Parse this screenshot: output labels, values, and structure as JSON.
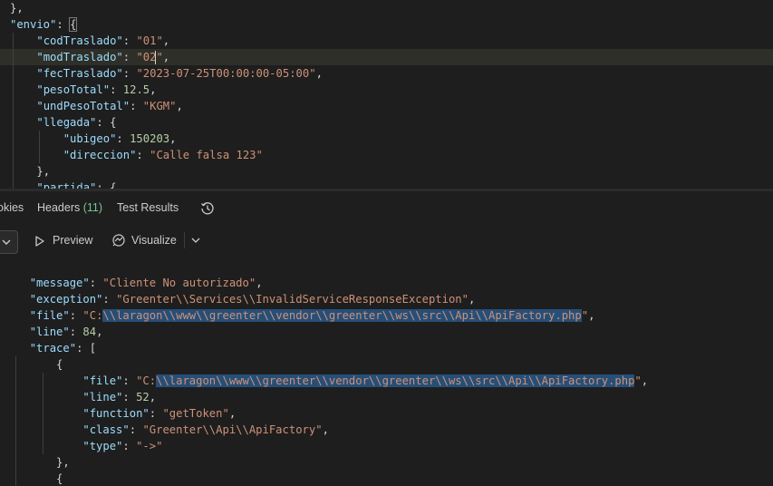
{
  "request_body": {
    "lines": [
      {
        "indent": "",
        "parts": [
          {
            "c": "p",
            "t": "},"
          }
        ]
      },
      {
        "indent": "",
        "parts": [
          {
            "c": "k",
            "t": "\"envio\""
          },
          {
            "c": "p",
            "t": ": "
          },
          {
            "c": "p",
            "t": "{",
            "box": true
          }
        ]
      },
      {
        "indent": "    ",
        "parts": [
          {
            "c": "k",
            "t": "\"codTraslado\""
          },
          {
            "c": "p",
            "t": ": "
          },
          {
            "c": "s",
            "t": "\"01\""
          },
          {
            "c": "p",
            "t": ","
          }
        ]
      },
      {
        "indent": "    ",
        "parts": [
          {
            "c": "k",
            "t": "\"modTraslado\""
          },
          {
            "c": "p",
            "t": ": "
          },
          {
            "c": "s",
            "t": "\"02\""
          },
          {
            "c": "p",
            "t": ","
          }
        ],
        "highlight": true
      },
      {
        "indent": "    ",
        "parts": [
          {
            "c": "k",
            "t": "\"fecTraslado\""
          },
          {
            "c": "p",
            "t": ": "
          },
          {
            "c": "s",
            "t": "\"2023-07-25T00:00:00-05:00\""
          },
          {
            "c": "p",
            "t": ","
          }
        ]
      },
      {
        "indent": "    ",
        "parts": [
          {
            "c": "k",
            "t": "\"pesoTotal\""
          },
          {
            "c": "p",
            "t": ": "
          },
          {
            "c": "n",
            "t": "12.5"
          },
          {
            "c": "p",
            "t": ","
          }
        ]
      },
      {
        "indent": "    ",
        "parts": [
          {
            "c": "k",
            "t": "\"undPesoTotal\""
          },
          {
            "c": "p",
            "t": ": "
          },
          {
            "c": "s",
            "t": "\"KGM\""
          },
          {
            "c": "p",
            "t": ","
          }
        ]
      },
      {
        "indent": "    ",
        "parts": [
          {
            "c": "k",
            "t": "\"llegada\""
          },
          {
            "c": "p",
            "t": ": {"
          }
        ]
      },
      {
        "indent": "        ",
        "parts": [
          {
            "c": "k",
            "t": "\"ubigeo\""
          },
          {
            "c": "p",
            "t": ": "
          },
          {
            "c": "n",
            "t": "150203"
          },
          {
            "c": "p",
            "t": ","
          }
        ]
      },
      {
        "indent": "        ",
        "parts": [
          {
            "c": "k",
            "t": "\"direccion\""
          },
          {
            "c": "p",
            "t": ": "
          },
          {
            "c": "s",
            "t": "\"Calle falsa 123\""
          }
        ]
      },
      {
        "indent": "    ",
        "parts": [
          {
            "c": "p",
            "t": "},"
          }
        ]
      },
      {
        "indent": "    ",
        "parts": [
          {
            "c": "k",
            "t": "\"partida\""
          },
          {
            "c": "p",
            "t": ": {"
          }
        ]
      }
    ]
  },
  "response_tabs": {
    "cookies": "okies",
    "headers": "Headers",
    "headers_count": "(11)",
    "test_results": "Test Results"
  },
  "toolbar": {
    "preview": "Preview",
    "visualize": "Visualize"
  },
  "response_body": {
    "lines": [
      {
        "indent": "  ",
        "parts": [
          {
            "c": "k",
            "t": "\"message\""
          },
          {
            "c": "p",
            "t": ": "
          },
          {
            "c": "s",
            "t": "\"Cliente No autorizado\""
          },
          {
            "c": "p",
            "t": ","
          }
        ]
      },
      {
        "indent": "  ",
        "parts": [
          {
            "c": "k",
            "t": "\"exception\""
          },
          {
            "c": "p",
            "t": ": "
          },
          {
            "c": "s",
            "t": "\"Greenter\\\\Services\\\\InvalidServiceResponseException\""
          },
          {
            "c": "p",
            "t": ","
          }
        ]
      },
      {
        "indent": "  ",
        "parts": [
          {
            "c": "k",
            "t": "\"file\""
          },
          {
            "c": "p",
            "t": ": "
          },
          {
            "c": "s",
            "t": "\"C:"
          },
          {
            "c": "s",
            "t": "\\\\laragon\\\\www\\\\greenter\\\\vendor\\\\greenter\\\\ws\\\\src\\\\Api\\\\ApiFactory.php",
            "sel": true
          },
          {
            "c": "s",
            "t": "\""
          },
          {
            "c": "p",
            "t": ","
          }
        ]
      },
      {
        "indent": "  ",
        "parts": [
          {
            "c": "k",
            "t": "\"line\""
          },
          {
            "c": "p",
            "t": ": "
          },
          {
            "c": "n",
            "t": "84"
          },
          {
            "c": "p",
            "t": ","
          }
        ]
      },
      {
        "indent": "  ",
        "parts": [
          {
            "c": "k",
            "t": "\"trace\""
          },
          {
            "c": "p",
            "t": ": ["
          }
        ]
      },
      {
        "indent": "      ",
        "parts": [
          {
            "c": "p",
            "t": "{"
          }
        ]
      },
      {
        "indent": "          ",
        "parts": [
          {
            "c": "k",
            "t": "\"file\""
          },
          {
            "c": "p",
            "t": ": "
          },
          {
            "c": "s",
            "t": "\"C:"
          },
          {
            "c": "s",
            "t": "\\\\laragon\\\\www\\\\greenter\\\\vendor\\\\greenter\\\\ws\\\\src\\\\Api\\\\ApiFactory.php",
            "sel": true
          },
          {
            "c": "s",
            "t": "\""
          },
          {
            "c": "p",
            "t": ","
          }
        ]
      },
      {
        "indent": "          ",
        "parts": [
          {
            "c": "k",
            "t": "\"line\""
          },
          {
            "c": "p",
            "t": ": "
          },
          {
            "c": "n",
            "t": "52"
          },
          {
            "c": "p",
            "t": ","
          }
        ]
      },
      {
        "indent": "          ",
        "parts": [
          {
            "c": "k",
            "t": "\"function\""
          },
          {
            "c": "p",
            "t": ": "
          },
          {
            "c": "s",
            "t": "\"getToken\""
          },
          {
            "c": "p",
            "t": ","
          }
        ]
      },
      {
        "indent": "          ",
        "parts": [
          {
            "c": "k",
            "t": "\"class\""
          },
          {
            "c": "p",
            "t": ": "
          },
          {
            "c": "s",
            "t": "\"Greenter\\\\Api\\\\ApiFactory\""
          },
          {
            "c": "p",
            "t": ","
          }
        ]
      },
      {
        "indent": "          ",
        "parts": [
          {
            "c": "k",
            "t": "\"type\""
          },
          {
            "c": "p",
            "t": ": "
          },
          {
            "c": "s",
            "t": "\"->\""
          }
        ]
      },
      {
        "indent": "      ",
        "parts": [
          {
            "c": "p",
            "t": "},"
          }
        ]
      },
      {
        "indent": "      ",
        "parts": [
          {
            "c": "p",
            "t": "{"
          }
        ]
      }
    ]
  },
  "colors": {
    "background": "#1e1e1e",
    "key": "#9cdcfe",
    "string": "#ce9178",
    "number": "#b5cea8",
    "punctuation": "#d4d4d4",
    "selection": "#264f78",
    "headers_count": "#73c991"
  },
  "icons": {
    "history": "history-icon",
    "chevron": "chevron-down-icon",
    "preview": "play-icon",
    "visualize": "visualize-icon"
  }
}
